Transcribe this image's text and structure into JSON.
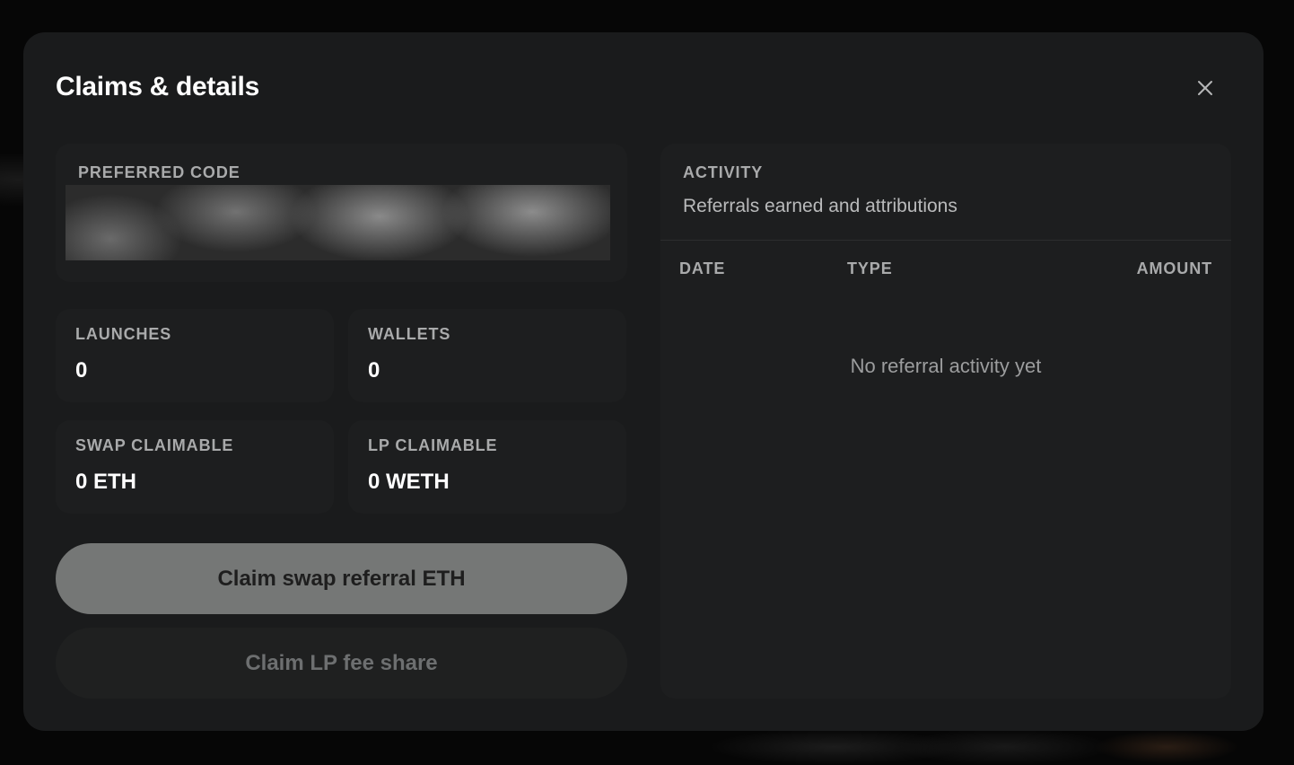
{
  "modal": {
    "title": "Claims & details",
    "close_icon": "close-icon"
  },
  "preferred_code": {
    "label": "PREFERRED CODE"
  },
  "stats": {
    "launches": {
      "label": "LAUNCHES",
      "value": "0"
    },
    "wallets": {
      "label": "WALLETS",
      "value": "0"
    },
    "swap_claimable": {
      "label": "SWAP CLAIMABLE",
      "value": "0 ETH"
    },
    "lp_claimable": {
      "label": "LP CLAIMABLE",
      "value": "0 WETH"
    }
  },
  "buttons": {
    "claim_swap": "Claim swap referral ETH",
    "claim_lp": "Claim LP fee share"
  },
  "activity": {
    "label": "ACTIVITY",
    "subtitle": "Referrals earned and attributions",
    "columns": [
      "DATE",
      "TYPE",
      "AMOUNT"
    ],
    "empty_message": "No referral activity yet"
  },
  "colors": {
    "modal_bg": "#1a1b1c",
    "card_bg": "#1d1e1f",
    "primary_button": "#757776",
    "disabled_button": "#1f2020"
  }
}
